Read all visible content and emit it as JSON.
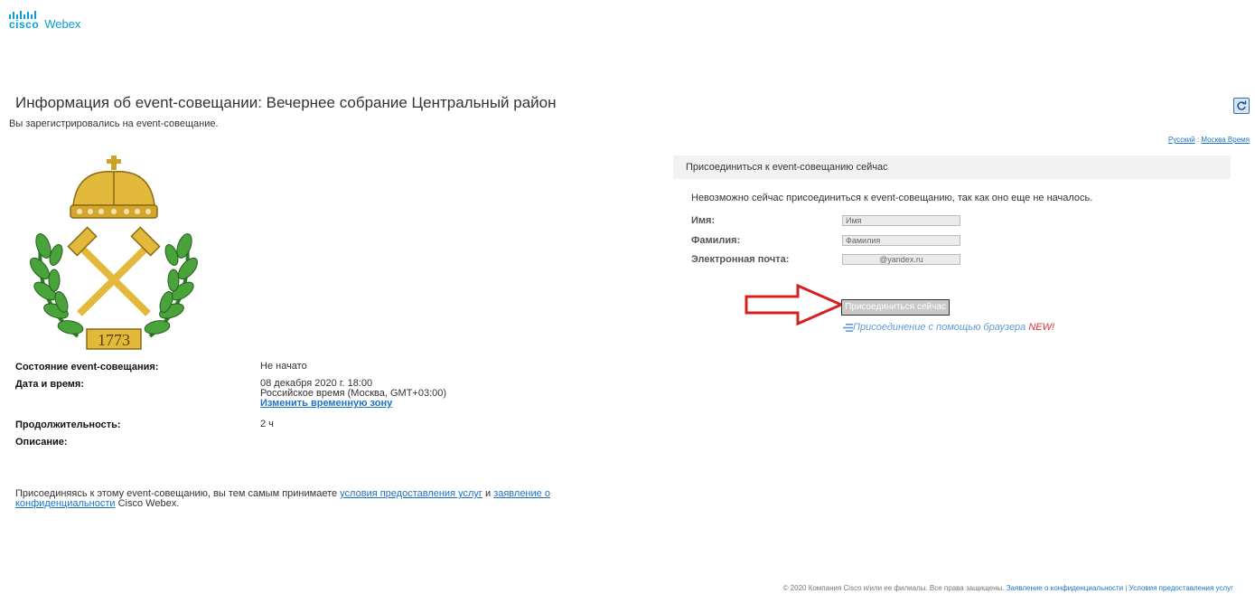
{
  "brand": {
    "cisco": "cisco",
    "product": "Webex"
  },
  "page": {
    "title": "Информация об event-совещании: Вечернее собрание Центральный район",
    "subtitle": "Вы зарегистрировались на event-совещание."
  },
  "topright": {
    "language": "Русский",
    "separator": ":",
    "timezone": "Москва Время"
  },
  "emblem": {
    "year": "1773"
  },
  "info": {
    "status_label": "Состояние event-совещания:",
    "status_value": "Не начато",
    "datetime_label": "Дата и время:",
    "datetime_value": "08 декабря 2020 г. 18:00",
    "timezone_value": "Российское время (Москва, GMT+03:00)",
    "change_tz_link": "Изменить временную зону",
    "duration_label": "Продолжительность:",
    "duration_value": "2 ч",
    "description_label": "Описание:"
  },
  "terms": {
    "prefix": "Присоединяясь к этому event-совещанию, вы тем самым принимаете",
    "tos_link": "условия предоставления услуг",
    "and": "и",
    "privacy_link": "заявление о конфиденциальности",
    "suffix": "Cisco Webex."
  },
  "join": {
    "header": "Присоединиться к event-совещанию сейчас",
    "notice": "Невозможно сейчас присоединиться к event-совещанию, так как оно еще не началось.",
    "first_name_label": "Имя:",
    "first_name_value": "Имя",
    "last_name_label": "Фамилия:",
    "last_name_value": "Фамилия",
    "email_label": "Электронная почта:",
    "email_value": "@yandex.ru",
    "join_button": "Присоединиться сейчас",
    "browser_join": "Присоединение с помощью браузера",
    "new_badge": "NEW!"
  },
  "footer": {
    "copyright": "© 2020 Компания Cisco и/или ее филиалы. Все права защищены.",
    "privacy_link": "Заявление о конфиденциальности",
    "separator": "|",
    "tos_link": "Условия предоставления услуг"
  },
  "colors": {
    "accent": "#049fd9",
    "link": "#1a73c9",
    "arrow": "#d62020",
    "new": "#e03030"
  }
}
